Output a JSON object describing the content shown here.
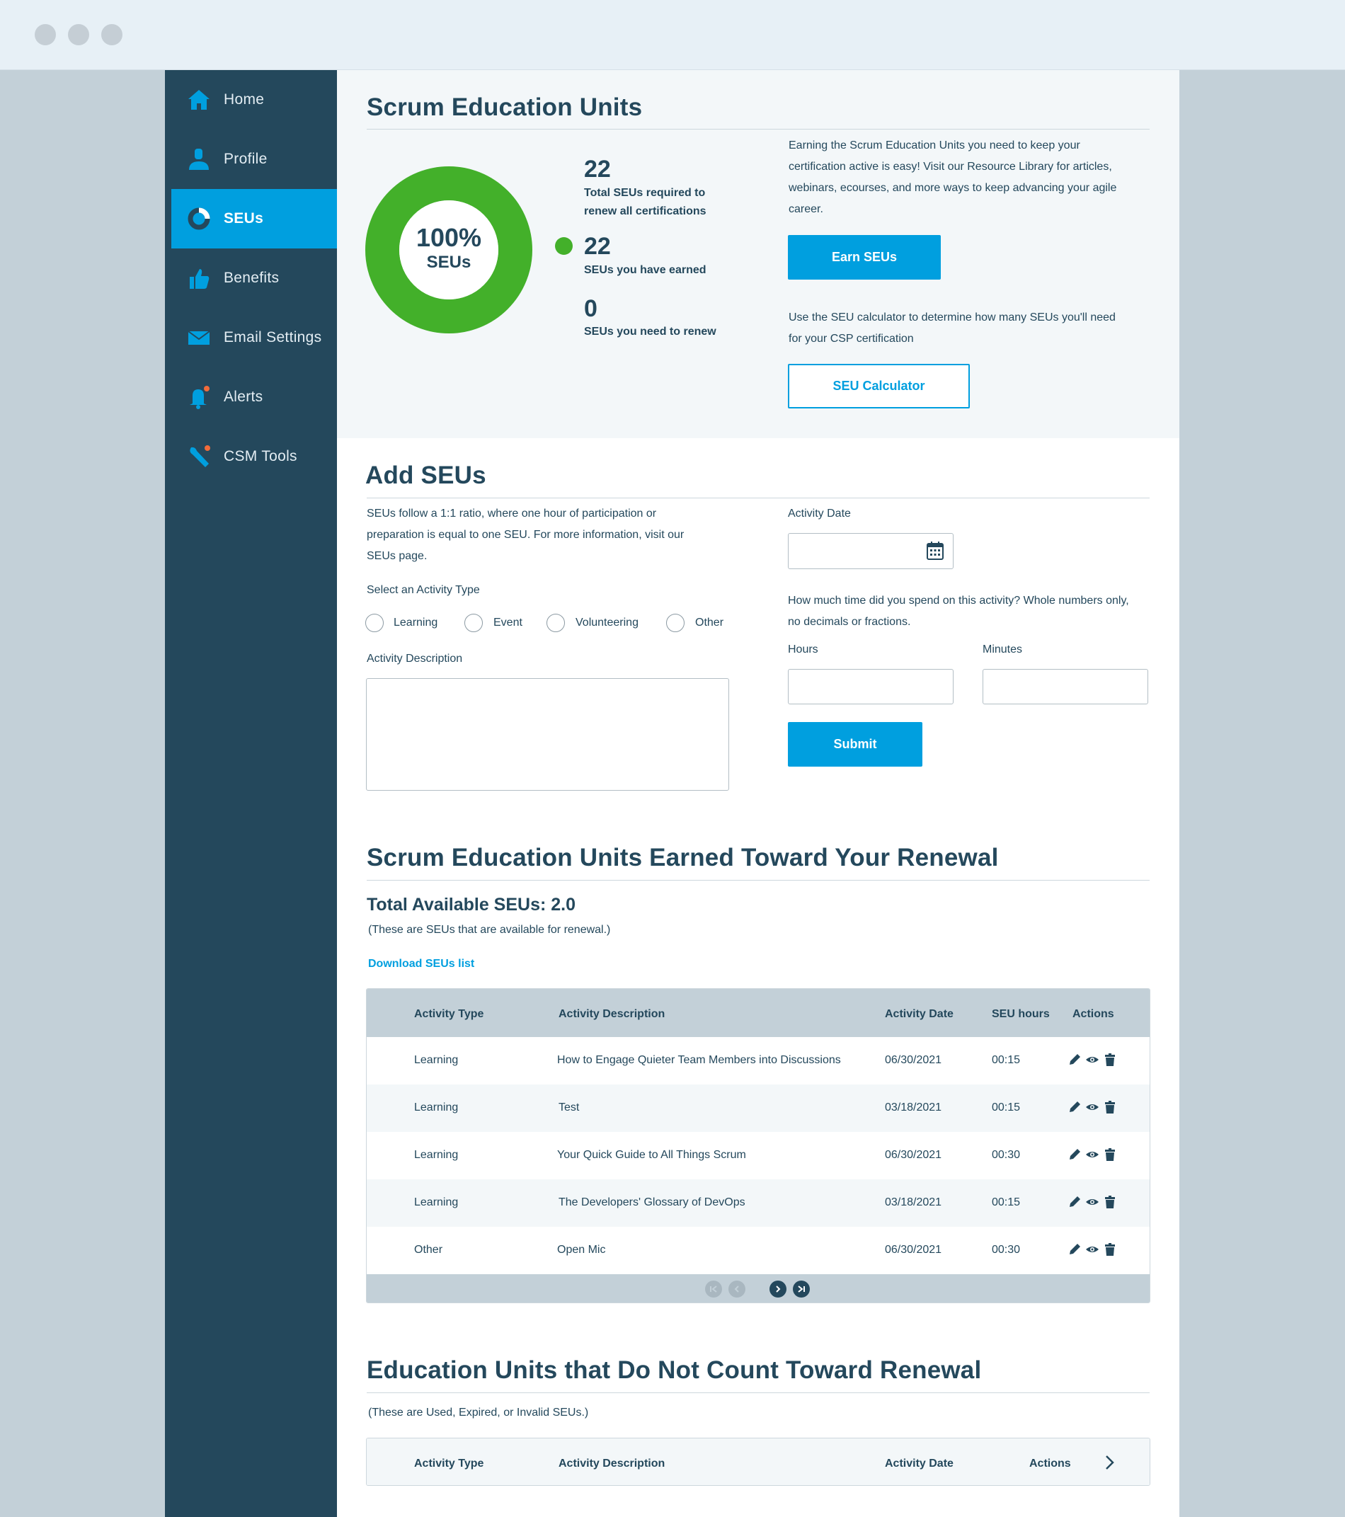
{
  "nav": {
    "home": "Home",
    "profile": "Profile",
    "seus": "SEUs",
    "benefits": "Benefits",
    "email_settings": "Email Settings",
    "alerts": "Alerts",
    "csm_tools": "CSM Tools",
    "active": "SEUs"
  },
  "overview": {
    "title": "Scrum Education Units",
    "donut_percent": "100%",
    "donut_unit": "SEUs",
    "progress_fraction": 1.0,
    "total_required_num": "22",
    "total_required_label_1": "Total SEUs required to",
    "total_required_label_2": "renew all certifications",
    "earned_num": "22",
    "earned_label": "SEUs you have earned",
    "need_num": "0",
    "need_label": "SEUs you need to renew",
    "intro_1": "Earning the Scrum Education Units you need to keep your",
    "intro_2": "certification active is easy! Visit our Resource Library for articles,",
    "intro_3": "webinars, ecourses, and more ways to keep advancing your agile",
    "intro_4": "career.",
    "earn_button": "Earn SEUs",
    "calc_text_1": "Use the SEU calculator to determine how many SEUs you'll need",
    "calc_text_2": "for your CSP certification",
    "calc_button": "SEU Calculator"
  },
  "add": {
    "title": "Add SEUs",
    "desc_1": "SEUs follow a 1:1 ratio, where one hour of participation or",
    "desc_2": "preparation is equal to one SEU. For more information, visit our",
    "desc_3": "SEUs page.",
    "activity_type_label": "Select an Activity Type",
    "types": [
      "Learning",
      "Event",
      "Volunteering",
      "Other"
    ],
    "activity_desc_label": "Activity Description",
    "activity_date_label": "Activity Date",
    "time_q_1": "How much time did you spend on this activity? Whole numbers only,",
    "time_q_2": "no decimals or fractions.",
    "hours_label": "Hours",
    "minutes_label": "Minutes",
    "submit": "Submit"
  },
  "earned": {
    "title": "Scrum Education Units Earned Toward Your Renewal",
    "total": "Total Available SEUs: 2.0",
    "note": "(These are SEUs that are available for renewal.)",
    "download": "Download SEUs list",
    "columns": [
      "Activity Type",
      "Activity Description",
      "Activity Date",
      "SEU hours",
      "Actions"
    ],
    "rows": [
      {
        "type": "Learning",
        "desc": "How to Engage Quieter Team Members into Discussions",
        "date": "06/30/2021",
        "hours": "00:15"
      },
      {
        "type": "Learning",
        "desc": "Test",
        "date": "03/18/2021",
        "hours": "00:15"
      },
      {
        "type": "Learning",
        "desc": "Your Quick Guide to All Things Scrum",
        "date": "06/30/2021",
        "hours": "00:30"
      },
      {
        "type": "Learning",
        "desc": "The Developers' Glossary of DevOps",
        "date": "03/18/2021",
        "hours": "00:15"
      },
      {
        "type": "Other",
        "desc": "Open Mic",
        "date": "06/30/2021",
        "hours": "00:30"
      }
    ]
  },
  "not_counted": {
    "title": "Education Units that Do Not Count Toward Renewal",
    "note": "(These are Used, Expired, or Invalid SEUs.)",
    "columns": [
      "Activity Type",
      "Activity Description",
      "Activity Date",
      "Actions"
    ]
  },
  "colors": {
    "accent": "#009fdf",
    "sidebar": "#24485c",
    "donut": "#43b02a"
  }
}
